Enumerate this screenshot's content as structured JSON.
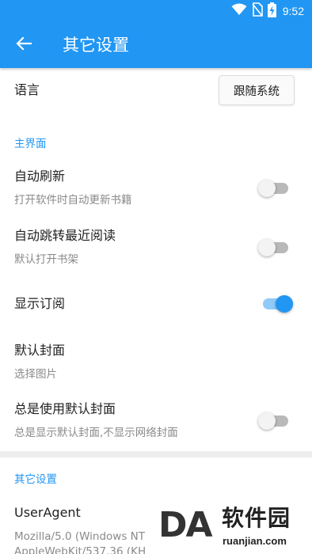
{
  "status_bar": {
    "time": "9:52",
    "icons": [
      "wifi-icon",
      "no-sim-icon",
      "battery-charging-icon"
    ]
  },
  "app_bar": {
    "back_icon": "arrow-back-icon",
    "title": "其它设置"
  },
  "language": {
    "label": "语言",
    "button_label": "跟随系统"
  },
  "main_section": {
    "header": "主界面",
    "items": [
      {
        "title": "自动刷新",
        "summary": "打开软件时自动更新书籍",
        "toggle": "off"
      },
      {
        "title": "自动跳转最近阅读",
        "summary": "默认打开书架",
        "toggle": "off"
      },
      {
        "title": "显示订阅",
        "summary": "",
        "toggle": "on"
      },
      {
        "title": "默认封面",
        "summary": "选择图片"
      },
      {
        "title": "总是使用默认封面",
        "summary": "总是显示默认封面,不显示网络封面",
        "toggle": "off"
      }
    ]
  },
  "other_section": {
    "header": "其它设置",
    "user_agent": {
      "title": "UserAgent",
      "summary_line1": "Mozilla/5.0 (Windows NT",
      "summary_line2": "AppleWebKit/537.36 (KH"
    }
  },
  "watermark": {
    "logo": "DA",
    "text": "软件园",
    "url": "ruanjian.com"
  },
  "colors": {
    "primary": "#2196F3",
    "switch_on_track": "#90CAF9",
    "switch_off_track": "#b9b9b9"
  }
}
